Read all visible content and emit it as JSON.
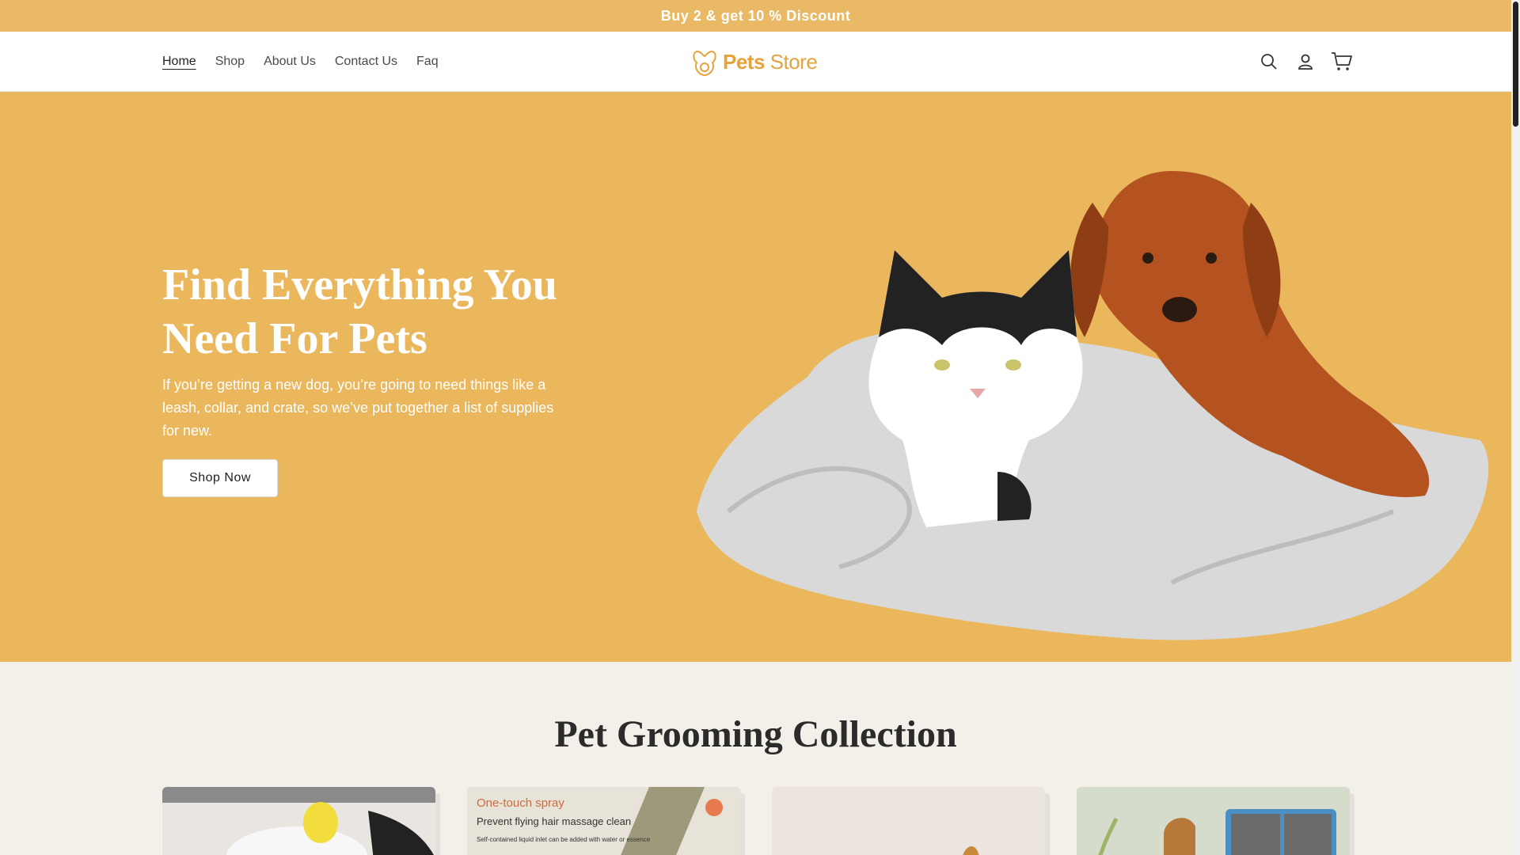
{
  "announcement": "Buy 2 & get 10 % Discount",
  "nav": {
    "items": [
      "Home",
      "Shop",
      "About Us",
      "Contact Us",
      "Faq"
    ],
    "active": "Home"
  },
  "logo": {
    "text_bold": "Pets",
    "text_light": "Store"
  },
  "header_icons": [
    "search-icon",
    "account-icon",
    "cart-icon"
  ],
  "hero": {
    "title": "Find Everything You Need For Pets",
    "text": "If you’re getting a new dog, you’re going to need things like a leash, collar, and crate, so we’ve put together a list of supplies for new.",
    "button": "Shop Now"
  },
  "collection": {
    "title": "Pet Grooming Collection",
    "cards": [
      {
        "caption": ""
      },
      {
        "caption_1": "One-touch spray",
        "caption_2": "Prevent flying hair massage clean",
        "caption_3": "Self-contained liquid inlet can be added with water or essence"
      },
      {
        "caption": ""
      },
      {
        "caption": ""
      }
    ]
  },
  "colors": {
    "announcement_bg": "#eab965",
    "hero_bg": "#eab75c",
    "accent": "#e6a23c",
    "page_bg": "#f3efe9"
  }
}
